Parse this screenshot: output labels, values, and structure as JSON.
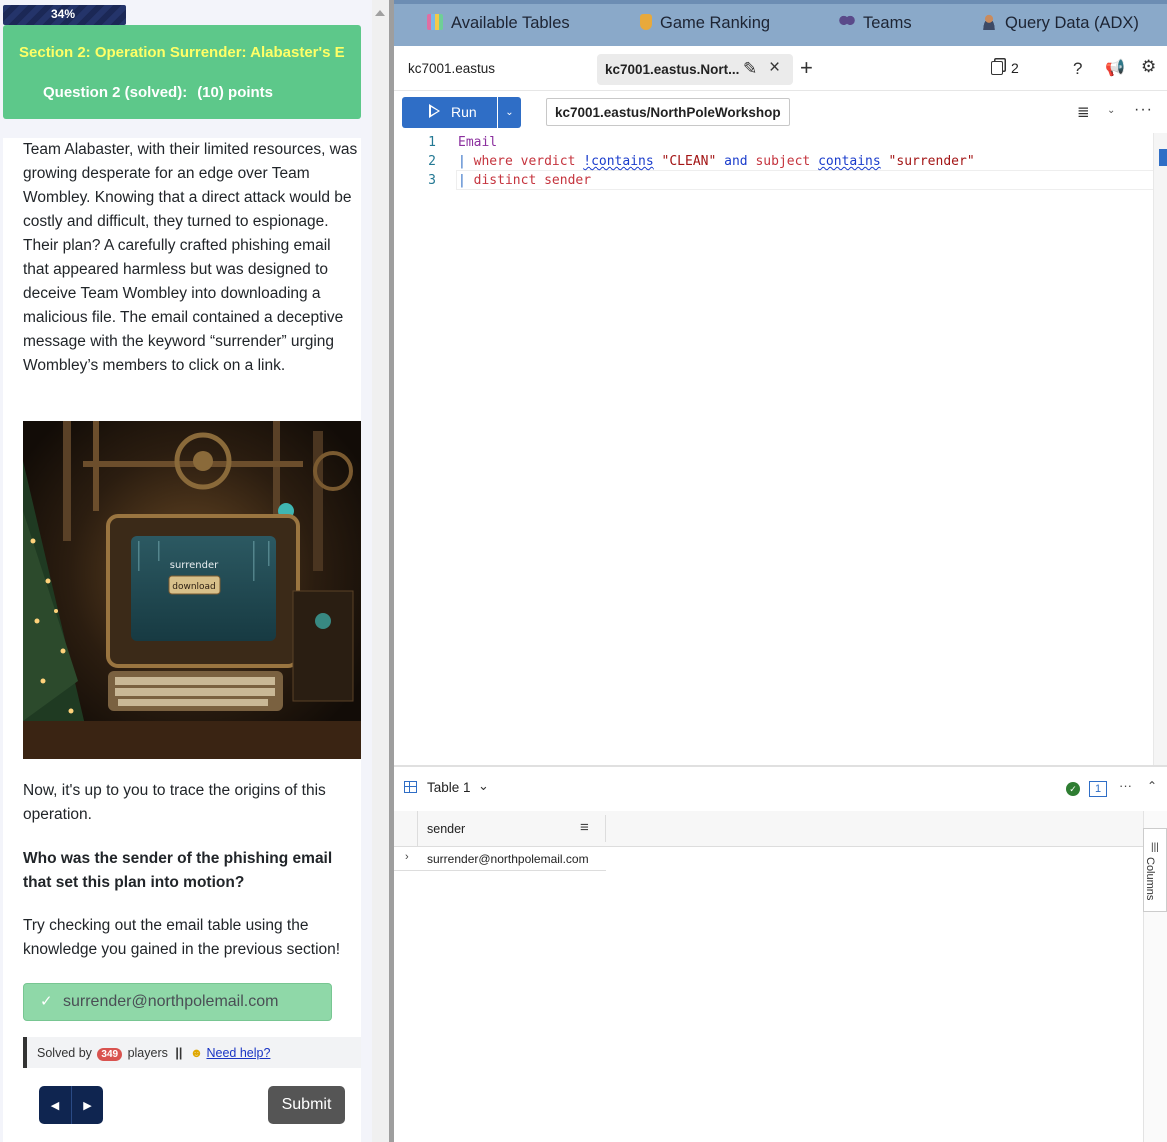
{
  "progress": {
    "label": "34%",
    "value": 34
  },
  "section": {
    "title": "Section 2: Operation Surrender: Alabaster's E",
    "question_label": "Question 2 (solved):",
    "points": "(10) points"
  },
  "content": {
    "intro": "Team Alabaster, with their limited resources, was growing desperate for an edge over Team Wombley. Knowing that a direct attack would be costly and difficult, they turned to espionage. Their plan? A carefully crafted phishing email that appeared harmless but was designed to deceive Team Wombley into downloading a malicious file. The email contained a deceptive message with the keyword “surrender” urging Wombley’s members to click on a link.",
    "image_text": "surrender",
    "image_button": "download",
    "trace": "Now, it's up to you to trace the origins of this operation.",
    "question": "Who was the sender of the phishing email that set this plan into motion?",
    "hint": "Try checking out the email table using the knowledge you gained in the previous section!"
  },
  "answer": {
    "value": "surrender@northpolemail.com"
  },
  "solved": {
    "prefix": "Solved by",
    "count": "349",
    "suffix": "players",
    "separator": "||",
    "help_link": "Need help?"
  },
  "buttons": {
    "submit": "Submit"
  },
  "topnav": {
    "items": [
      {
        "label": "Available Tables",
        "icon": "bar-chart-icon"
      },
      {
        "label": "Game Ranking",
        "icon": "trophy-icon"
      },
      {
        "label": "Teams",
        "icon": "people-icon"
      },
      {
        "label": "Query Data (ADX)",
        "icon": "person-icon"
      }
    ]
  },
  "tabs": {
    "tab1": "kc7001.eastus",
    "tab2": "kc7001.eastus.Nort...",
    "copies_count": "2"
  },
  "toolbar": {
    "run_label": "Run",
    "db_path": "kc7001.eastus/NorthPoleWorkshop"
  },
  "editor": {
    "lines": [
      {
        "num": "1",
        "text": "Email"
      },
      {
        "num": "2",
        "text": "| where verdict !contains \"CLEAN\" and subject contains \"surrender\""
      },
      {
        "num": "3",
        "text": "| distinct sender"
      }
    ],
    "tokens": {
      "table": "Email",
      "where": "where",
      "verdict": "verdict",
      "not_contains": "!contains",
      "clean": "\"CLEAN\"",
      "and": "and",
      "subject": "subject",
      "contains": "contains",
      "surrender": "\"surrender\"",
      "distinct": "distinct",
      "sender": "sender"
    }
  },
  "results": {
    "table_label": "Table 1",
    "count_badge": "1",
    "columns_panel": "Columns",
    "columns": [
      "sender"
    ],
    "rows": [
      [
        "surrender@northpolemail.com"
      ]
    ]
  },
  "colors": {
    "header_green": "#5dc88a",
    "section_title_yellow": "#ffff66",
    "answer_green": "#8fd8a8",
    "run_blue": "#2f6ec6",
    "topnav_blue": "#8aa9c9",
    "solved_badge_red": "#d9534f",
    "nav_button_navy": "#0f2550"
  }
}
